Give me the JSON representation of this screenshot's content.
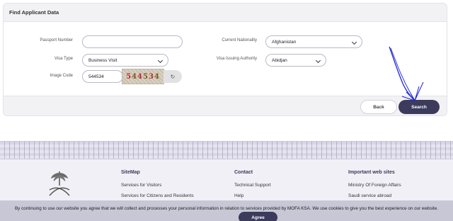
{
  "panel": {
    "title": "Find Applicant Data"
  },
  "form": {
    "passport_label": "Passport Number",
    "passport_value": "",
    "nationality_label": "Current Nationality",
    "nationality_value": "Afghanistan",
    "visa_type_label": "Visa Type",
    "visa_type_value": "Business Visit",
    "issuing_authority_label": "Visa Issuing Authority",
    "issuing_authority_value": "Abidjan",
    "image_code_label": "Image Code",
    "image_code_value": "544534",
    "captcha_chars": [
      "5",
      "4",
      "4",
      "5",
      "3",
      "4"
    ]
  },
  "buttons": {
    "back": "Back",
    "search": "Search"
  },
  "footer": {
    "sitemap_title": "SiteMap",
    "sitemap_links": [
      "Services for Visitors",
      "Services for Citizens and Residents"
    ],
    "contact_title": "Contact",
    "contact_links": [
      "Technical Support",
      "Help"
    ],
    "important_title": "Important web sites",
    "important_links": [
      "Ministry Of Foreign Affairs",
      "Saudi service abroad"
    ]
  },
  "cookie": {
    "text": "By continuing to use our website you agree that we will collect and processes your personal information in relation to services provided by MOFA KSA. We use cookies to give you the best experience on our website.",
    "agree": "Agree"
  },
  "colors": {
    "primary": "#3c3b5c",
    "panel_bg": "#f2f2f5",
    "annotation": "#1a23d6"
  },
  "icons": {
    "refresh": "refresh-icon",
    "emblem": "saudi-emblem-icon",
    "chevron": "chevron-down-icon"
  }
}
